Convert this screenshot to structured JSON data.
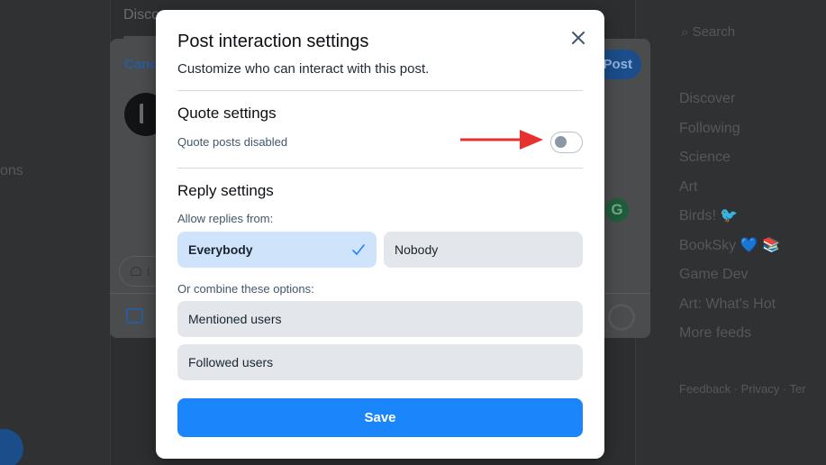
{
  "background": {
    "feed_tab": "Disco",
    "left_partial_text": "ons",
    "composer": {
      "cancel_label": "Canc",
      "post_label": "Post",
      "interaction_label": "I"
    },
    "search_placeholder": "Search",
    "nav_items": [
      "Discover",
      "Following",
      "Science",
      "Art",
      "Birds! 🐦",
      "BookSky 💙 📚",
      "Game Dev",
      "Art: What's Hot",
      "More feeds"
    ],
    "footer": "Feedback · Privacy · Ter"
  },
  "modal": {
    "title": "Post interaction settings",
    "subtitle": "Customize who can interact with this post.",
    "close_icon": "close-icon",
    "quote": {
      "heading": "Quote settings",
      "status_label": "Quote posts disabled",
      "toggle_on": false
    },
    "reply": {
      "heading": "Reply settings",
      "allow_label": "Allow replies from:",
      "options": [
        {
          "label": "Everybody",
          "selected": true
        },
        {
          "label": "Nobody",
          "selected": false
        }
      ],
      "combine_label": "Or combine these options:",
      "combine_options": [
        {
          "label": "Mentioned users"
        },
        {
          "label": "Followed users"
        }
      ]
    },
    "save_label": "Save"
  },
  "colors": {
    "accent": "#1b85fb",
    "selected_option_bg": "#cfe4fb",
    "option_bg": "#e3e7eb",
    "annotation_arrow": "#e8312f"
  }
}
